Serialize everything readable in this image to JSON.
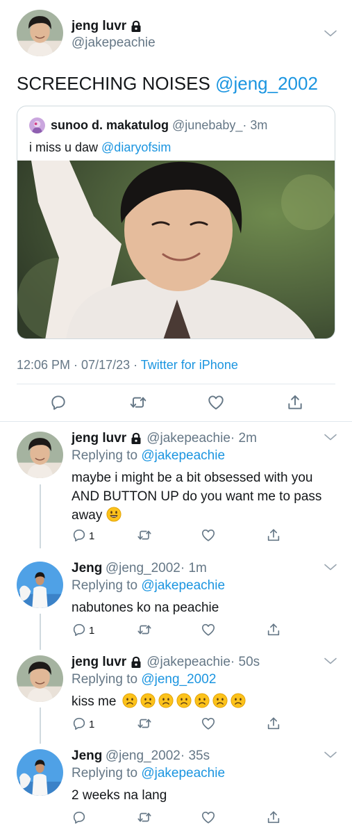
{
  "main_tweet": {
    "display_name": "jeng luvr",
    "handle": "@jakepeachie",
    "text_prefix": "SCREECHING NOISES ",
    "mention": "@jeng_2002",
    "quoted": {
      "display_name": "sunoo d. makatulog",
      "handle": "@junebaby_",
      "time": "· 3m",
      "text_prefix": "i miss u daw ",
      "mention": "@diaryofsim"
    },
    "timestamp": "12:06 PM · 07/17/23 · ",
    "source": "Twitter for iPhone"
  },
  "replies": [
    {
      "display_name": "jeng luvr",
      "handle": "@jakepeachie",
      "time": "· 2m",
      "replying_label": "Replying to ",
      "replying_to": "@jakepeachie",
      "line1": "maybe i might be a bit obsessed with you",
      "line2": "AND BUTTON UP do you want me to pass",
      "line3": "away",
      "reply_count": "1"
    },
    {
      "display_name": "Jeng",
      "handle": "@jeng_2002",
      "time": "· 1m",
      "replying_label": "Replying to ",
      "replying_to": "@jakepeachie",
      "line1": "nabutones ko na peachie",
      "reply_count": "1"
    },
    {
      "display_name": "jeng luvr",
      "handle": "@jakepeachie",
      "time": "· 50s",
      "replying_label": "Replying to ",
      "replying_to": "@jeng_2002",
      "line1": "kiss me",
      "reply_count": "1"
    },
    {
      "display_name": "Jeng",
      "handle": "@jeng_2002",
      "time": "· 35s",
      "replying_label": "Replying to ",
      "replying_to": "@jakepeachie",
      "line1": "2 weeks na lang"
    }
  ],
  "colors": {
    "link": "#1b95e0",
    "secondary_text": "#657786",
    "divider": "#e1e8ed"
  },
  "icons": {
    "reply": "reply-icon",
    "retweet": "retweet-icon",
    "like": "heart-icon",
    "share": "share-icon",
    "lock": "lock-icon",
    "more": "chevron-down-icon"
  }
}
